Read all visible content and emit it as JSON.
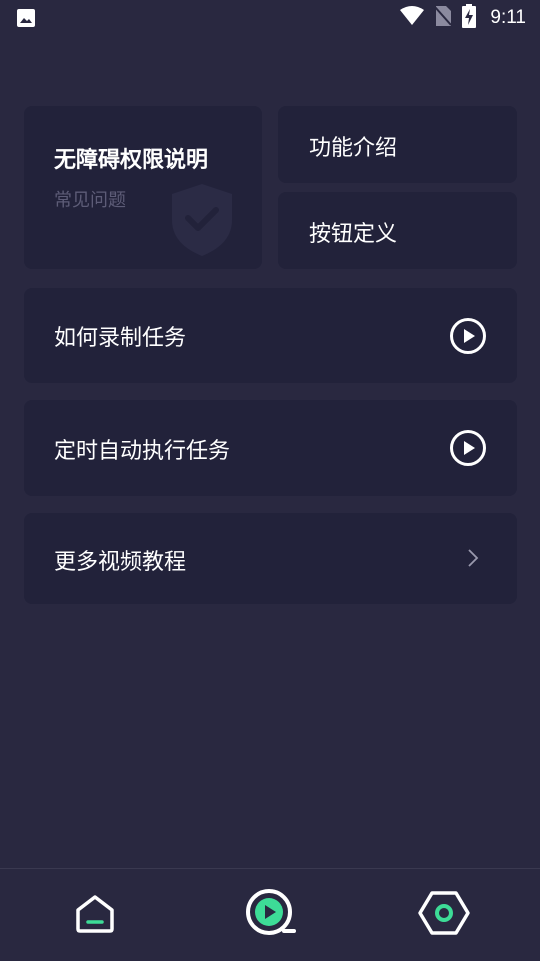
{
  "status_bar": {
    "time": "9:11"
  },
  "main_card": {
    "title": "无障碍权限说明",
    "subtitle": "常见问题"
  },
  "feature_card": {
    "label": "功能介绍"
  },
  "button_card": {
    "label": "按钮定义"
  },
  "rows": {
    "record": {
      "label": "如何录制任务"
    },
    "timer": {
      "label": "定时自动执行任务"
    },
    "more": {
      "label": "更多视频教程"
    }
  },
  "bottom_nav": {
    "items": [
      "home-icon",
      "record-play-icon",
      "settings-icon"
    ],
    "accent_color": "#3ddc97"
  },
  "colors": {
    "background": "#292840",
    "card": "#22223a",
    "muted_text": "#5d5c77"
  }
}
